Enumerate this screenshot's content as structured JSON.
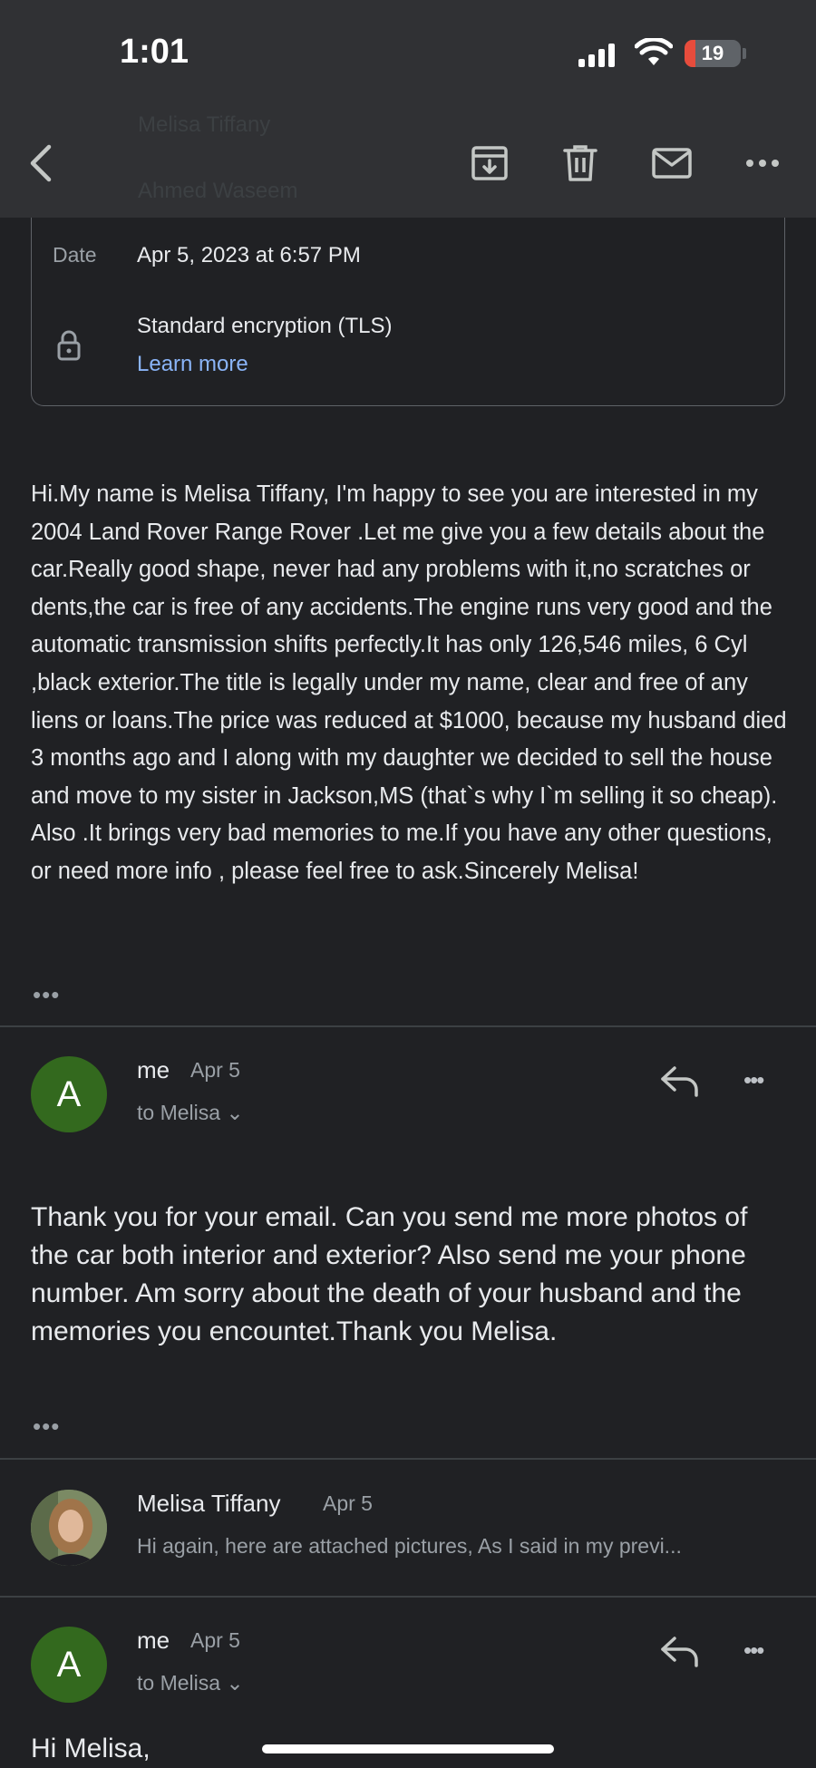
{
  "status_bar": {
    "time": "1:01",
    "battery": "19",
    "battery_fraction": 0.19
  },
  "ghost": {
    "line1": "Melisa Tiffany",
    "line2": "Ahmed Waseem"
  },
  "toolbar": {
    "back_icon": "chevron-left-icon",
    "archive_icon": "archive-icon",
    "delete_icon": "trash-icon",
    "mark_unread_icon": "mail-icon",
    "more_icon": "more-horizontal-icon"
  },
  "details": {
    "date_label": "Date",
    "date_value": "Apr 5, 2023 at 6:57 PM",
    "encryption": "Standard encryption (TLS)",
    "learn_more": "Learn more"
  },
  "message1": {
    "body": "Hi.My name is Melisa Tiffany, I'm happy to see you are interested in my 2004 Land Rover Range Rover .Let me give you a few details about the car.Really good shape, never had any problems with it,no scratches or dents,the car is free of any accidents.The engine runs very good and the automatic transmission shifts perfectly.It has only 126,546 miles, 6 Cyl ,black exterior.The title is legally under my name, clear and free of any liens or loans.The price was reduced at $1000, because my husband died 3 months ago and I along with my daughter we decided to sell the house and move to my sister in Jackson,MS (that`s why I`m selling it so cheap). Also .It brings very bad memories to me.If you have any other questions, or need more info , please feel free to ask.Sincerely Melisa!",
    "expand": "•••"
  },
  "message2": {
    "avatar_letter": "A",
    "sender": "me",
    "date": "Apr 5",
    "to": "to Melisa ⌄",
    "body": "Thank you for your email. Can you send me more photos of the car both interior and exterior? Also send me your phone number. Am sorry about the death of your husband and the memories you encountet.Thank you Melisa.",
    "expand": "•••"
  },
  "message3": {
    "sender": "Melisa Tiffany",
    "date": "Apr 5",
    "snippet": "Hi again, here are attached pictures, As I said in my previ..."
  },
  "message4": {
    "avatar_letter": "A",
    "sender": "me",
    "date": "Apr 5",
    "to": "to Melisa ⌄",
    "greeting": "Hi Melisa,"
  },
  "more_glyph": "•••"
}
